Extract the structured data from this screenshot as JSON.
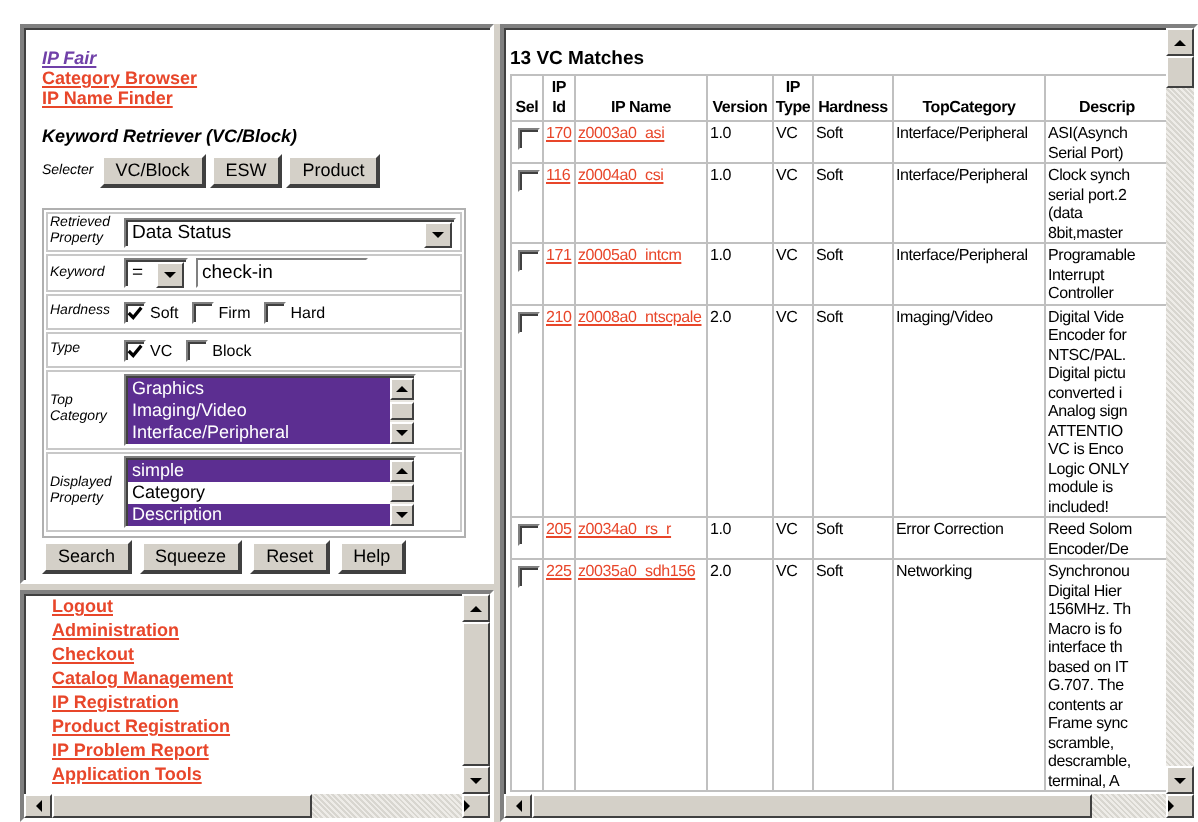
{
  "nav_links": [
    {
      "label": "IP Fair",
      "visited": true
    },
    {
      "label": "Category Browser",
      "visited": false
    },
    {
      "label": "IP Name Finder",
      "visited": false
    }
  ],
  "retriever": {
    "title": "Keyword Retriever (VC/Block)",
    "selecter_label": "Selecter",
    "selecter_buttons": [
      "VC/Block",
      "ESW",
      "Product"
    ],
    "fields": [
      {
        "kind": "select",
        "label": "Retrieved Property",
        "value": "Data Status"
      },
      {
        "kind": "keyword",
        "label": "Keyword",
        "operator": "=",
        "value": "check-in"
      },
      {
        "kind": "checks",
        "label": "Hardness",
        "options": [
          {
            "label": "Soft",
            "checked": true
          },
          {
            "label": "Firm",
            "checked": false
          },
          {
            "label": "Hard",
            "checked": false
          }
        ]
      },
      {
        "kind": "checks",
        "label": "Type",
        "options": [
          {
            "label": "VC",
            "checked": true
          },
          {
            "label": "Block",
            "checked": false
          }
        ]
      },
      {
        "kind": "list",
        "label": "Top Category",
        "options": [
          {
            "label": "Graphics",
            "selected": true
          },
          {
            "label": "Imaging/Video",
            "selected": true
          },
          {
            "label": "Interface/Peripheral",
            "selected": true
          }
        ]
      },
      {
        "kind": "list",
        "label": "Displayed Property",
        "options": [
          {
            "label": "simple",
            "selected": true
          },
          {
            "label": "Category",
            "selected": false
          },
          {
            "label": "Description",
            "selected": true
          }
        ]
      }
    ],
    "buttons": [
      "Search",
      "Squeeze",
      "Reset",
      "Help"
    ]
  },
  "menu_links": [
    "Logout",
    "Administration",
    "Checkout",
    "Catalog Management",
    "IP Registration",
    "Product Registration",
    "IP Problem Report",
    "Application Tools"
  ],
  "results": {
    "title": "13 VC Matches",
    "columns": [
      "Sel",
      "IP Id",
      "IP Name",
      "Version",
      "IP Type",
      "Hardness",
      "TopCategory",
      "Descrip"
    ],
    "rows": [
      {
        "selected": false,
        "id": "170",
        "name": "z0003a0_asi",
        "version": "1.0",
        "type": "VC",
        "hardness": "Soft",
        "category": "Interface/Peripheral",
        "description": "ASI(Asynch\nSerial Port)"
      },
      {
        "selected": false,
        "id": "116",
        "name": "z0004a0_csi",
        "version": "1.0",
        "type": "VC",
        "hardness": "Soft",
        "category": "Interface/Peripheral",
        "description": "Clock synch\nserial port.2\n(data\n8bit,master"
      },
      {
        "selected": false,
        "id": "171",
        "name": "z0005a0_intcm",
        "version": "1.0",
        "type": "VC",
        "hardness": "Soft",
        "category": "Interface/Peripheral",
        "description": "Programable\nInterrupt\nController"
      },
      {
        "selected": false,
        "id": "210",
        "name": "z0008a0_ntscpale",
        "version": "2.0",
        "type": "VC",
        "hardness": "Soft",
        "category": "Imaging/Video",
        "description": "Digital Vide\nEncoder for\nNTSC/PAL.\nDigital pictu\nconverted i\nAnalog sign\nATTENTIO\nVC is Enco\nLogic ONLY\nmodule is\nincluded!"
      },
      {
        "selected": false,
        "id": "205",
        "name": "z0034a0_rs_r",
        "version": "1.0",
        "type": "VC",
        "hardness": "Soft",
        "category": "Error Correction",
        "description": "Reed Solom\nEncoder/De"
      },
      {
        "selected": false,
        "id": "225",
        "name": "z0035a0_sdh156",
        "version": "2.0",
        "type": "VC",
        "hardness": "Soft",
        "category": "Networking",
        "description": "Synchronou\nDigital Hier\n156MHz. Th\nMacro is fo\ninterface th\nbased on IT\nG.707. The\ncontents ar\nFrame sync\nscramble,\ndescramble,\nterminal, A"
      }
    ]
  }
}
